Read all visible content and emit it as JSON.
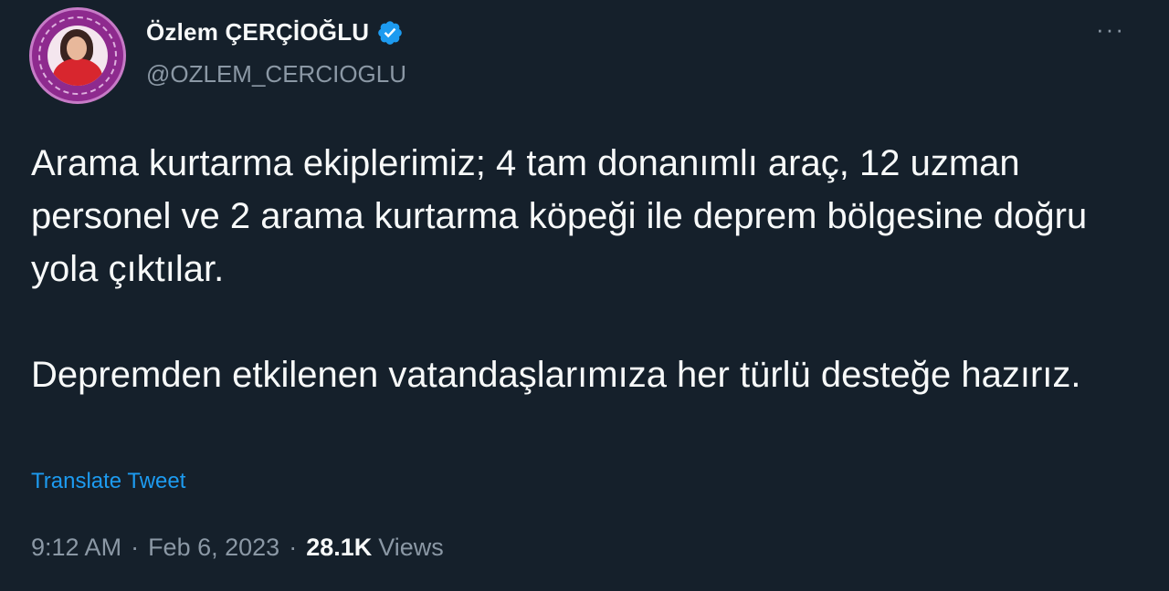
{
  "author": {
    "name": "Özlem ÇERÇİOĞLU",
    "handle": "@OZLEM_CERCIOGLU",
    "verified": true
  },
  "more_menu": "···",
  "tweet": {
    "paragraphs": [
      "Arama kurtarma ekiplerimiz; 4 tam donanımlı araç, 12 uzman personel ve 2 arama kurtarma köpeği ile deprem bölgesine doğru yola çıktılar.",
      "Depremden etkilenen vatandaşlarımıza her türlü desteğe hazırız."
    ]
  },
  "translate_label": "Translate Tweet",
  "meta": {
    "time": "9:12 AM",
    "separator": "·",
    "date": "Feb 6, 2023",
    "views_count": "28.1K",
    "views_label": "Views"
  },
  "colors": {
    "background": "#15202b",
    "text": "#f7f9f9",
    "muted": "#8b98a5",
    "accent": "#1d9bf0"
  },
  "icons": {
    "verified": "verified-badge-icon",
    "more": "more-options-icon"
  }
}
